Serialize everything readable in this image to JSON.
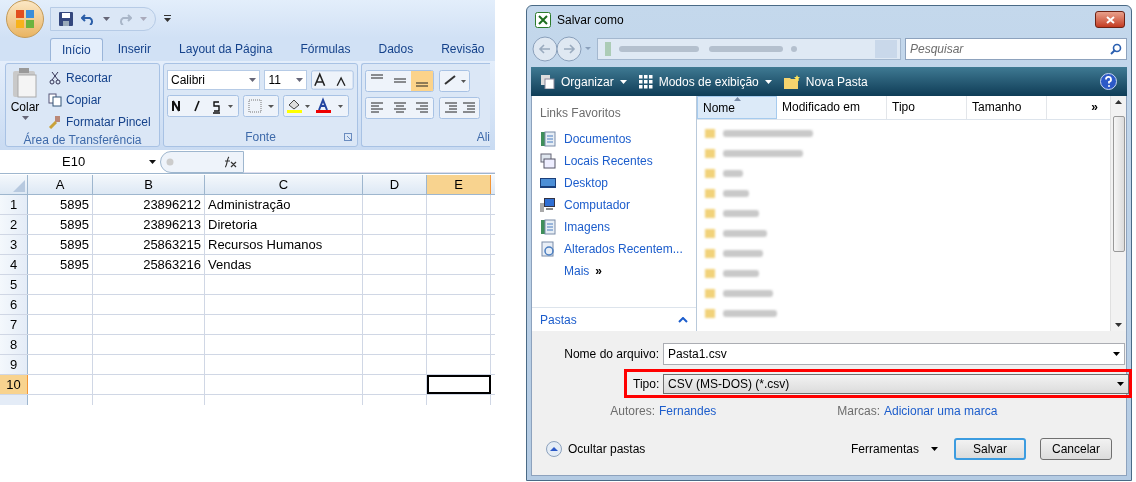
{
  "excel": {
    "tabs": [
      {
        "label": "Início",
        "selected": true
      },
      {
        "label": "Inserir",
        "selected": false
      },
      {
        "label": "Layout da Página",
        "selected": false
      },
      {
        "label": "Fórmulas",
        "selected": false
      },
      {
        "label": "Dados",
        "selected": false
      },
      {
        "label": "Revisão",
        "selected": false
      }
    ],
    "clipboard": {
      "paste": "Colar",
      "items": [
        "Recortar",
        "Copiar",
        "Formatar Pincel"
      ],
      "title": "Área de Transferência"
    },
    "font": {
      "name": "Calibri",
      "size": "11",
      "title": "Fonte"
    },
    "alignment": {
      "title": "Ali"
    },
    "name_box": "E10",
    "columns": [
      {
        "label": "A",
        "selected": false
      },
      {
        "label": "B",
        "selected": false
      },
      {
        "label": "C",
        "selected": false
      },
      {
        "label": "D",
        "selected": false
      },
      {
        "label": "E",
        "selected": true
      }
    ],
    "rows": [
      {
        "header": "1",
        "selected": false,
        "cells": [
          "5895",
          "23896212",
          "Administração",
          "",
          ""
        ]
      },
      {
        "header": "2",
        "selected": false,
        "cells": [
          "5895",
          "23896213",
          "Diretoria",
          "",
          ""
        ]
      },
      {
        "header": "3",
        "selected": false,
        "cells": [
          "5895",
          "25863215",
          "Recursos Humanos",
          "",
          ""
        ]
      },
      {
        "header": "4",
        "selected": false,
        "cells": [
          "5895",
          "25863216",
          "Vendas",
          "",
          ""
        ]
      },
      {
        "header": "5",
        "selected": false,
        "cells": [
          "",
          "",
          "",
          "",
          ""
        ]
      },
      {
        "header": "6",
        "selected": false,
        "cells": [
          "",
          "",
          "",
          "",
          ""
        ]
      },
      {
        "header": "7",
        "selected": false,
        "cells": [
          "",
          "",
          "",
          "",
          ""
        ]
      },
      {
        "header": "8",
        "selected": false,
        "cells": [
          "",
          "",
          "",
          "",
          ""
        ]
      },
      {
        "header": "9",
        "selected": false,
        "cells": [
          "",
          "",
          "",
          "",
          ""
        ]
      },
      {
        "header": "10",
        "selected": true,
        "cells": [
          "",
          "",
          "",
          "",
          ""
        ]
      }
    ]
  },
  "dialog": {
    "title": "Salvar como",
    "search": {
      "placeholder": "Pesquisar"
    },
    "toolbar": [
      "Organizar",
      "Modos de exibição",
      "Nova Pasta"
    ],
    "favorites_title": "Links Favoritos",
    "favorites": [
      "Documentos",
      "Locais Recentes",
      "Desktop",
      "Computador",
      "Imagens",
      "Alterados Recentem..."
    ],
    "more": "Mais",
    "more_glyph": "»",
    "folders_label": "Pastas",
    "columns": [
      {
        "label": "Nome",
        "sorted": true
      },
      {
        "label": "Modificado em",
        "sorted": false
      },
      {
        "label": "Tipo",
        "sorted": false
      },
      {
        "label": "Tamanho",
        "sorted": false
      }
    ],
    "columns_more": "»",
    "filename": {
      "label": "Nome do arquivo:",
      "value": "Pasta1.csv"
    },
    "type": {
      "label": "Tipo:",
      "value": "CSV (MS-DOS) (*.csv)",
      "highlighted": true
    },
    "authors": {
      "label": "Autores:",
      "value": "Fernandes"
    },
    "tags": {
      "label": "Marcas:",
      "value": "Adicionar uma marca"
    },
    "hide_folders": "Ocultar pastas",
    "tools": "Ferramentas",
    "buttons": [
      {
        "label": "Salvar",
        "default": true
      },
      {
        "label": "Cancelar",
        "default": false
      }
    ]
  }
}
